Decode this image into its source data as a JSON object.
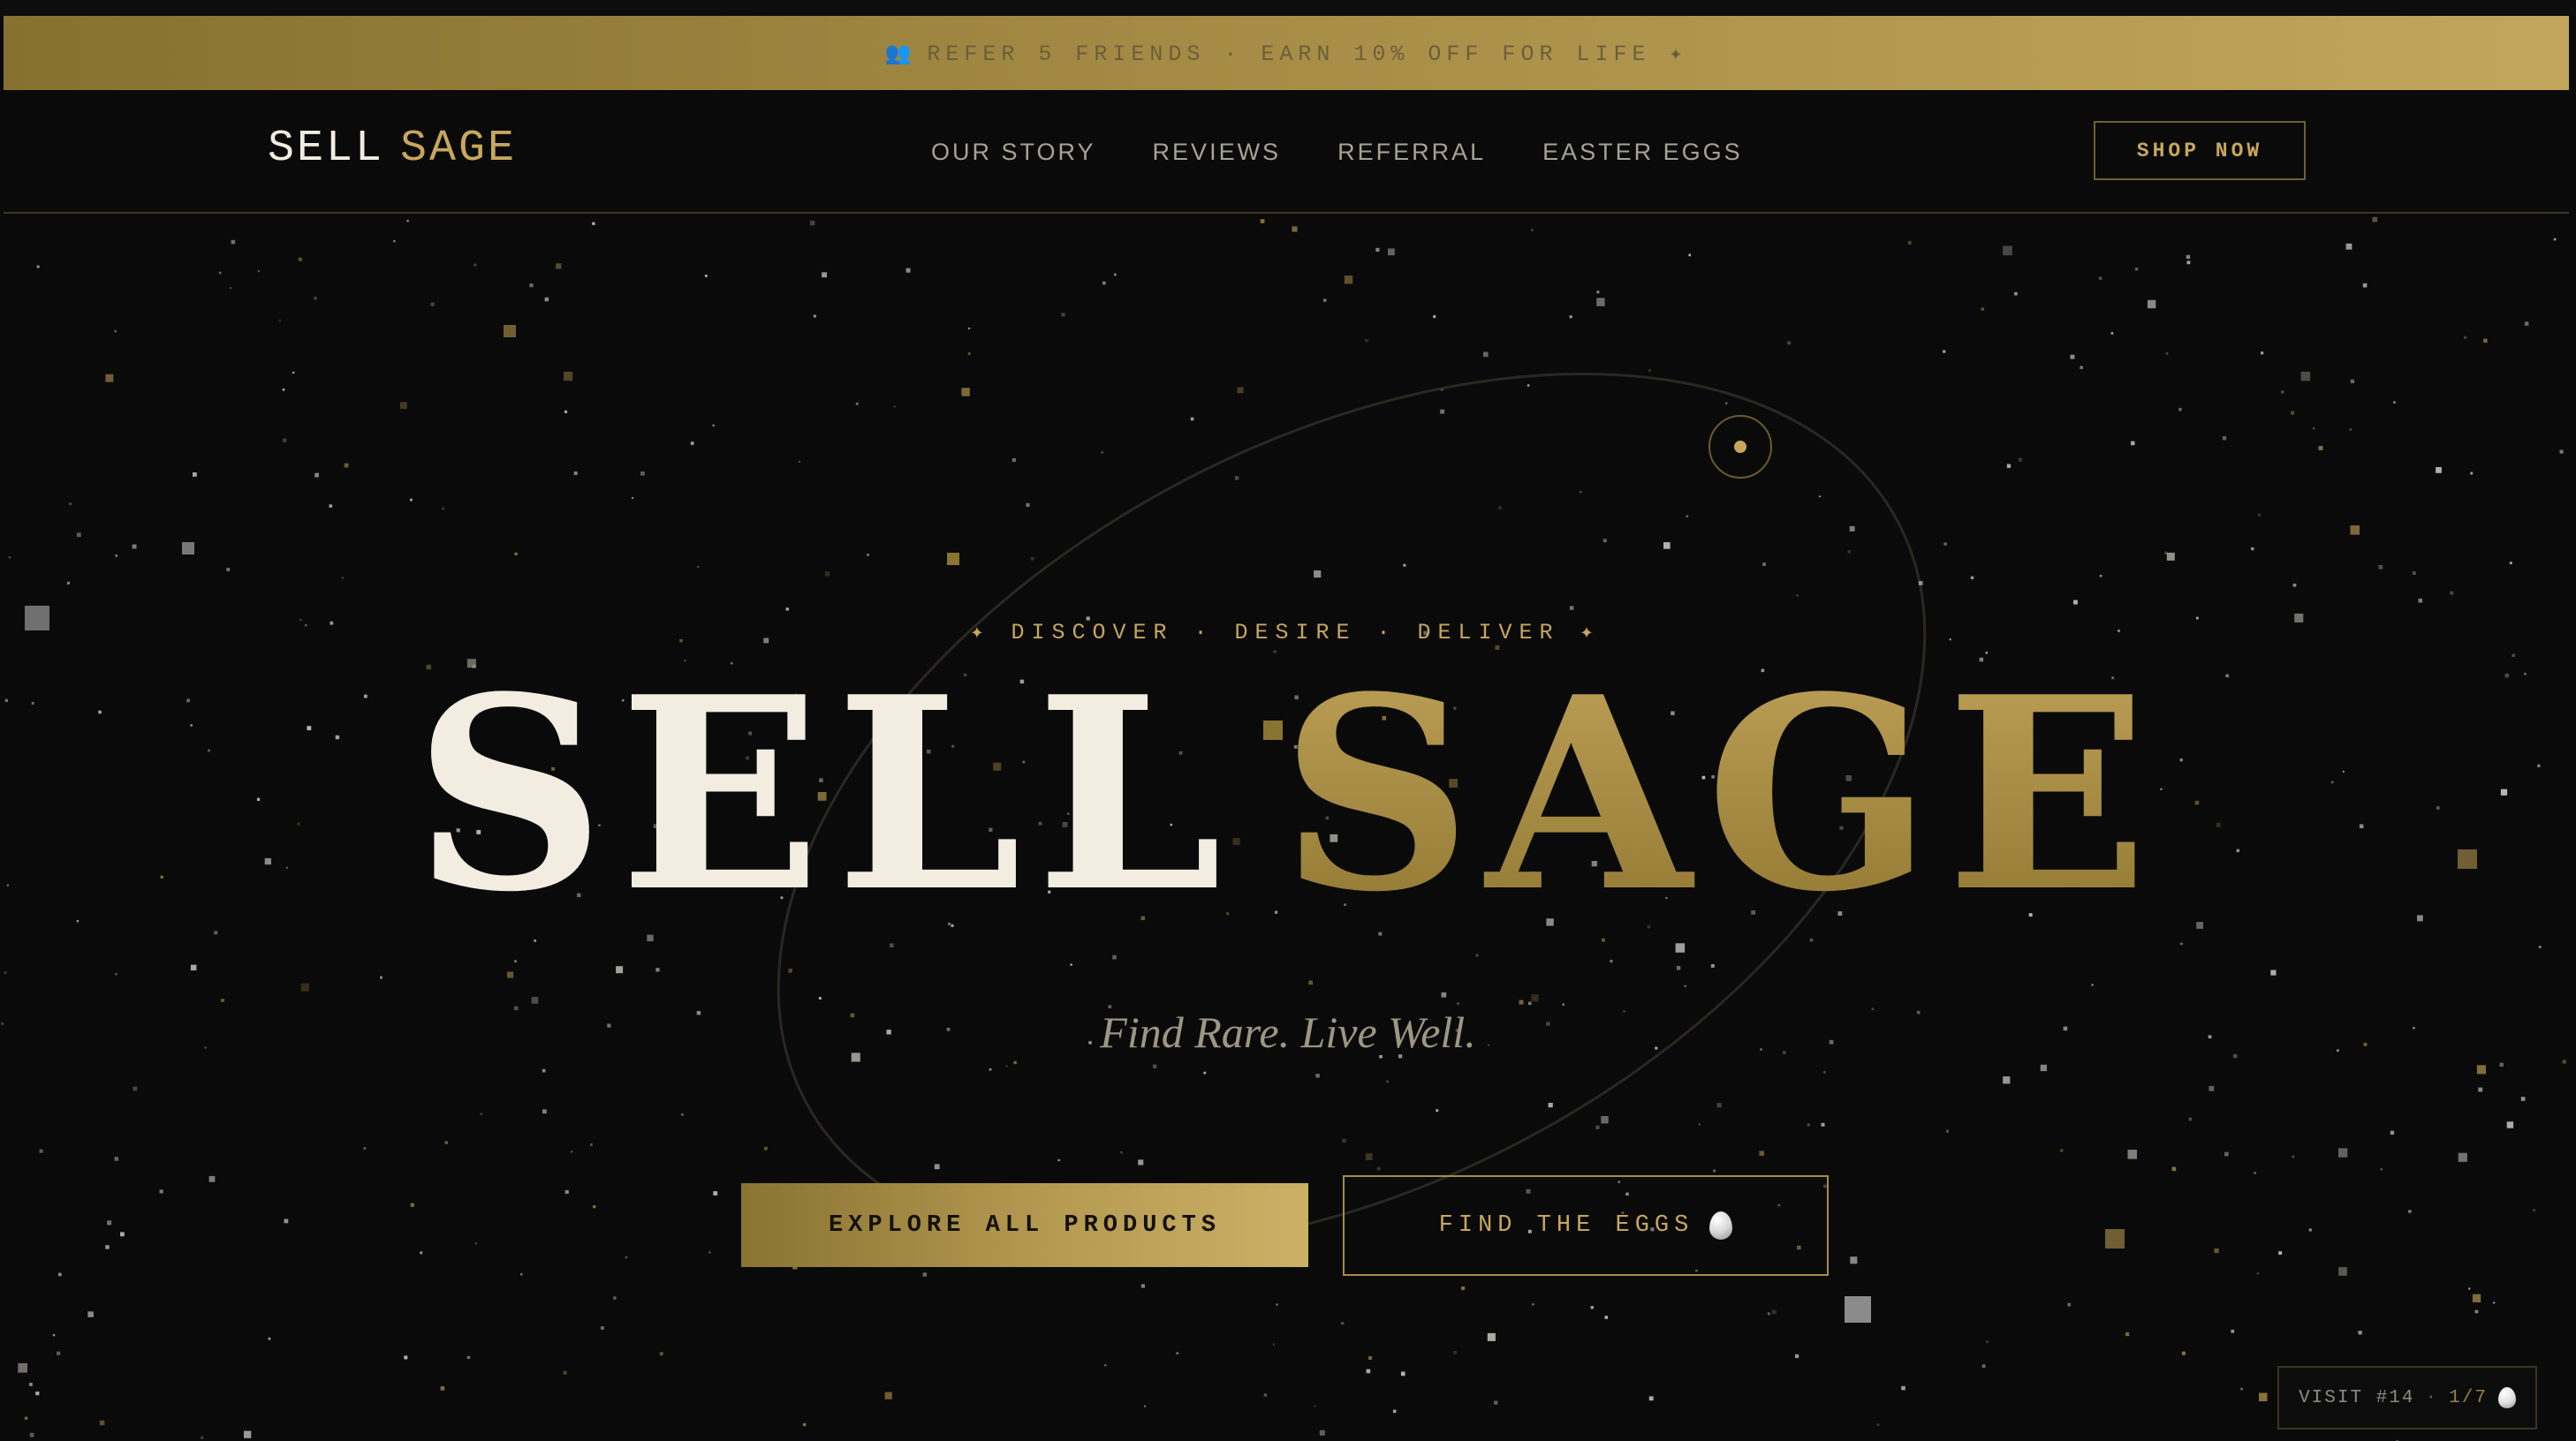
{
  "promo": {
    "icon": "people-icon",
    "text": "REFER 5 FRIENDS · EARN 10% OFF FOR LIFE ✦"
  },
  "nav": {
    "logo_word1": "SELL",
    "logo_word2": "SAGE",
    "links": [
      "OUR STORY",
      "REVIEWS",
      "REFERRAL",
      "EASTER EGGS"
    ],
    "shop_label": "SHOP NOW"
  },
  "hero": {
    "tagline": "✦  DISCOVER · DESIRE · DELIVER  ✦",
    "title_word1": "SELL",
    "title_word2": "SAGE",
    "subtitle": "Find Rare. Live Well.",
    "primary_cta": "EXPLORE ALL PRODUCTS",
    "secondary_cta": "FIND THE EGGS"
  },
  "visit": {
    "label": "VISIT #14",
    "progress": "1/7"
  },
  "colors": {
    "background": "#0a0a0a",
    "gold": "#c8a75c",
    "cream": "#f2ede0"
  }
}
